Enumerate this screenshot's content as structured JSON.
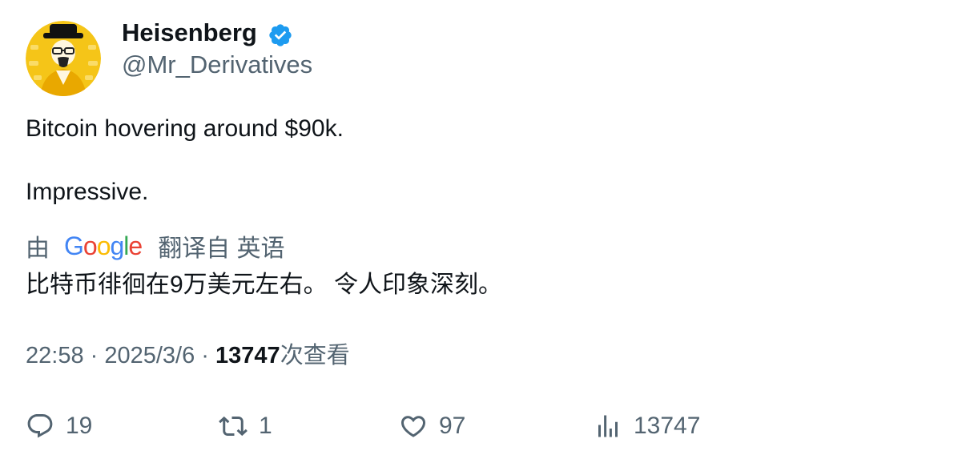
{
  "author": {
    "display_name": "Heisenberg",
    "handle": "@Mr_Derivatives",
    "verified": true,
    "verified_color": "#1d9bf0"
  },
  "tweet": {
    "lines": [
      "Bitcoin hovering around $90k.",
      "Impressive."
    ]
  },
  "translation": {
    "prefix": "由",
    "provider": "Google",
    "suffix": "翻译自 英语",
    "text": "比特币徘徊在9万美元左右。 令人印象深刻。"
  },
  "meta": {
    "time": "22:58",
    "separator": " · ",
    "date": "2025/3/6",
    "views_count": "13747",
    "views_label": "次查看"
  },
  "actions": {
    "replies": "19",
    "retweets": "1",
    "likes": "97",
    "views": "13747"
  },
  "colors": {
    "text_primary": "#0f1419",
    "text_secondary": "#536471",
    "avatar_background": "#f5c518"
  }
}
